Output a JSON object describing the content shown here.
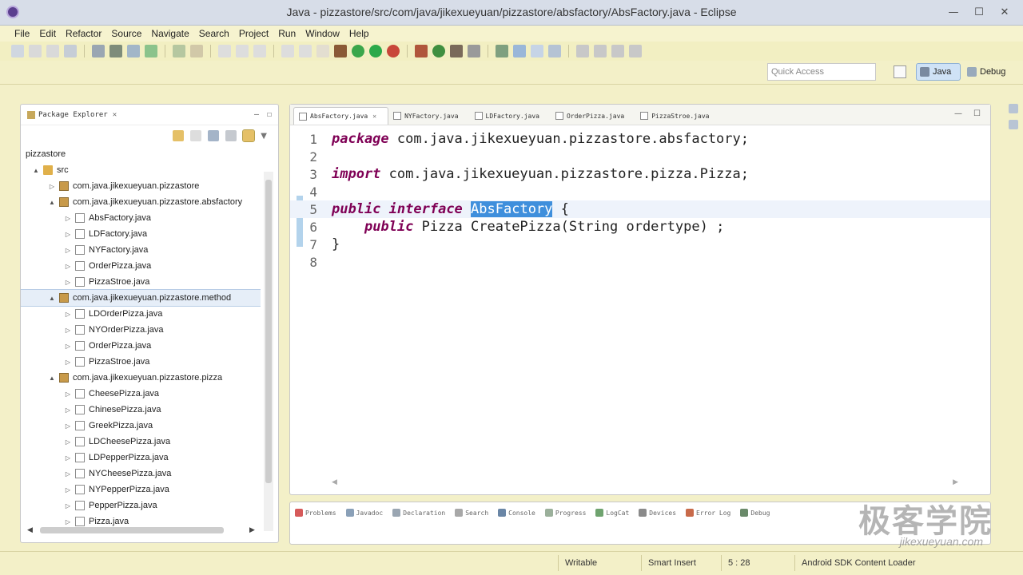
{
  "window": {
    "title": "Java - pizzastore/src/com/java/jikexueyuan/pizzastore/absfactory/AbsFactory.java - Eclipse"
  },
  "menu": [
    "File",
    "Edit",
    "Refactor",
    "Source",
    "Navigate",
    "Search",
    "Project",
    "Run",
    "Window",
    "Help"
  ],
  "toolbar": {
    "quick_access_placeholder": "Quick Access",
    "perspectives": {
      "java": "Java",
      "debug": "Debug"
    }
  },
  "package_explorer": {
    "title": "Package Explorer",
    "root": "pizzastore",
    "tree": [
      {
        "label": "src",
        "kind": "folder",
        "level": 1,
        "twisty": "▲"
      },
      {
        "label": "com.java.jikexueyuan.pizzastore",
        "kind": "pkg",
        "level": 2,
        "twisty": "▷"
      },
      {
        "label": "com.java.jikexueyuan.pizzastore.absfactory",
        "kind": "pkg",
        "level": 2,
        "twisty": "▲"
      },
      {
        "label": "AbsFactory.java",
        "kind": "java",
        "level": 3,
        "twisty": "▷"
      },
      {
        "label": "LDFactory.java",
        "kind": "java",
        "level": 3,
        "twisty": "▷"
      },
      {
        "label": "NYFactory.java",
        "kind": "java",
        "level": 3,
        "twisty": "▷"
      },
      {
        "label": "OrderPizza.java",
        "kind": "java",
        "level": 3,
        "twisty": "▷"
      },
      {
        "label": "PizzaStroe.java",
        "kind": "java",
        "level": 3,
        "twisty": "▷"
      },
      {
        "label": "com.java.jikexueyuan.pizzastore.method",
        "kind": "pkg",
        "level": 2,
        "twisty": "▲",
        "selected": true
      },
      {
        "label": "LDOrderPizza.java",
        "kind": "java",
        "level": 3,
        "twisty": "▷"
      },
      {
        "label": "NYOrderPizza.java",
        "kind": "java",
        "level": 3,
        "twisty": "▷"
      },
      {
        "label": "OrderPizza.java",
        "kind": "java",
        "level": 3,
        "twisty": "▷"
      },
      {
        "label": "PizzaStroe.java",
        "kind": "java",
        "level": 3,
        "twisty": "▷"
      },
      {
        "label": "com.java.jikexueyuan.pizzastore.pizza",
        "kind": "pkg",
        "level": 2,
        "twisty": "▲"
      },
      {
        "label": "CheesePizza.java",
        "kind": "java",
        "level": 3,
        "twisty": "▷"
      },
      {
        "label": "ChinesePizza.java",
        "kind": "java",
        "level": 3,
        "twisty": "▷"
      },
      {
        "label": "GreekPizza.java",
        "kind": "java",
        "level": 3,
        "twisty": "▷"
      },
      {
        "label": "LDCheesePizza.java",
        "kind": "java",
        "level": 3,
        "twisty": "▷"
      },
      {
        "label": "LDPepperPizza.java",
        "kind": "java",
        "level": 3,
        "twisty": "▷"
      },
      {
        "label": "NYCheesePizza.java",
        "kind": "java",
        "level": 3,
        "twisty": "▷"
      },
      {
        "label": "NYPepperPizza.java",
        "kind": "java",
        "level": 3,
        "twisty": "▷"
      },
      {
        "label": "PepperPizza.java",
        "kind": "java",
        "level": 3,
        "twisty": "▷"
      },
      {
        "label": "Pizza.java",
        "kind": "java",
        "level": 3,
        "twisty": "▷"
      }
    ]
  },
  "editor": {
    "tabs": [
      {
        "label": "AbsFactory.java",
        "active": true
      },
      {
        "label": "NYFactory.java",
        "active": false
      },
      {
        "label": "LDFactory.java",
        "active": false
      },
      {
        "label": "OrderPizza.java",
        "active": false
      },
      {
        "label": "PizzaStroe.java",
        "active": false
      }
    ],
    "lines": [
      {
        "n": "1",
        "parts": [
          [
            "kw",
            "package"
          ],
          [
            "",
            " com.java.jikexueyuan.pizzastore.absfactory;"
          ]
        ]
      },
      {
        "n": "2",
        "parts": []
      },
      {
        "n": "3",
        "parts": [
          [
            "kw",
            "import"
          ],
          [
            "",
            " com.java.jikexueyuan.pizzastore.pizza.Pizza;"
          ]
        ]
      },
      {
        "n": "4",
        "parts": []
      },
      {
        "n": "5",
        "parts": [
          [
            "kw",
            "public"
          ],
          [
            "",
            " "
          ],
          [
            "kw",
            "interface"
          ],
          [
            "",
            " "
          ],
          [
            "sel",
            "AbsFactory"
          ],
          [
            "",
            " {"
          ]
        ],
        "current": true
      },
      {
        "n": "6",
        "parts": [
          [
            "",
            "    "
          ],
          [
            "kw",
            "public"
          ],
          [
            "",
            " Pizza CreatePizza(String ordertype) ;"
          ]
        ]
      },
      {
        "n": "7",
        "parts": [
          [
            "",
            "}"
          ]
        ]
      },
      {
        "n": "8",
        "parts": []
      }
    ]
  },
  "bottom_tabs": [
    "Problems",
    "Javadoc",
    "Declaration",
    "Search",
    "Console",
    "Progress",
    "LogCat",
    "Devices",
    "Error Log",
    "Debug"
  ],
  "status": {
    "writable": "Writable",
    "insert_mode": "Smart Insert",
    "position": "5 : 28",
    "loader": "Android SDK Content Loader"
  },
  "watermark": {
    "title": "极客学院",
    "sub": "jikexueyuan.com"
  },
  "colors": {
    "keyword": "#7f0055",
    "selection": "#3f8fdc",
    "window_bg": "#f3f0c8"
  }
}
